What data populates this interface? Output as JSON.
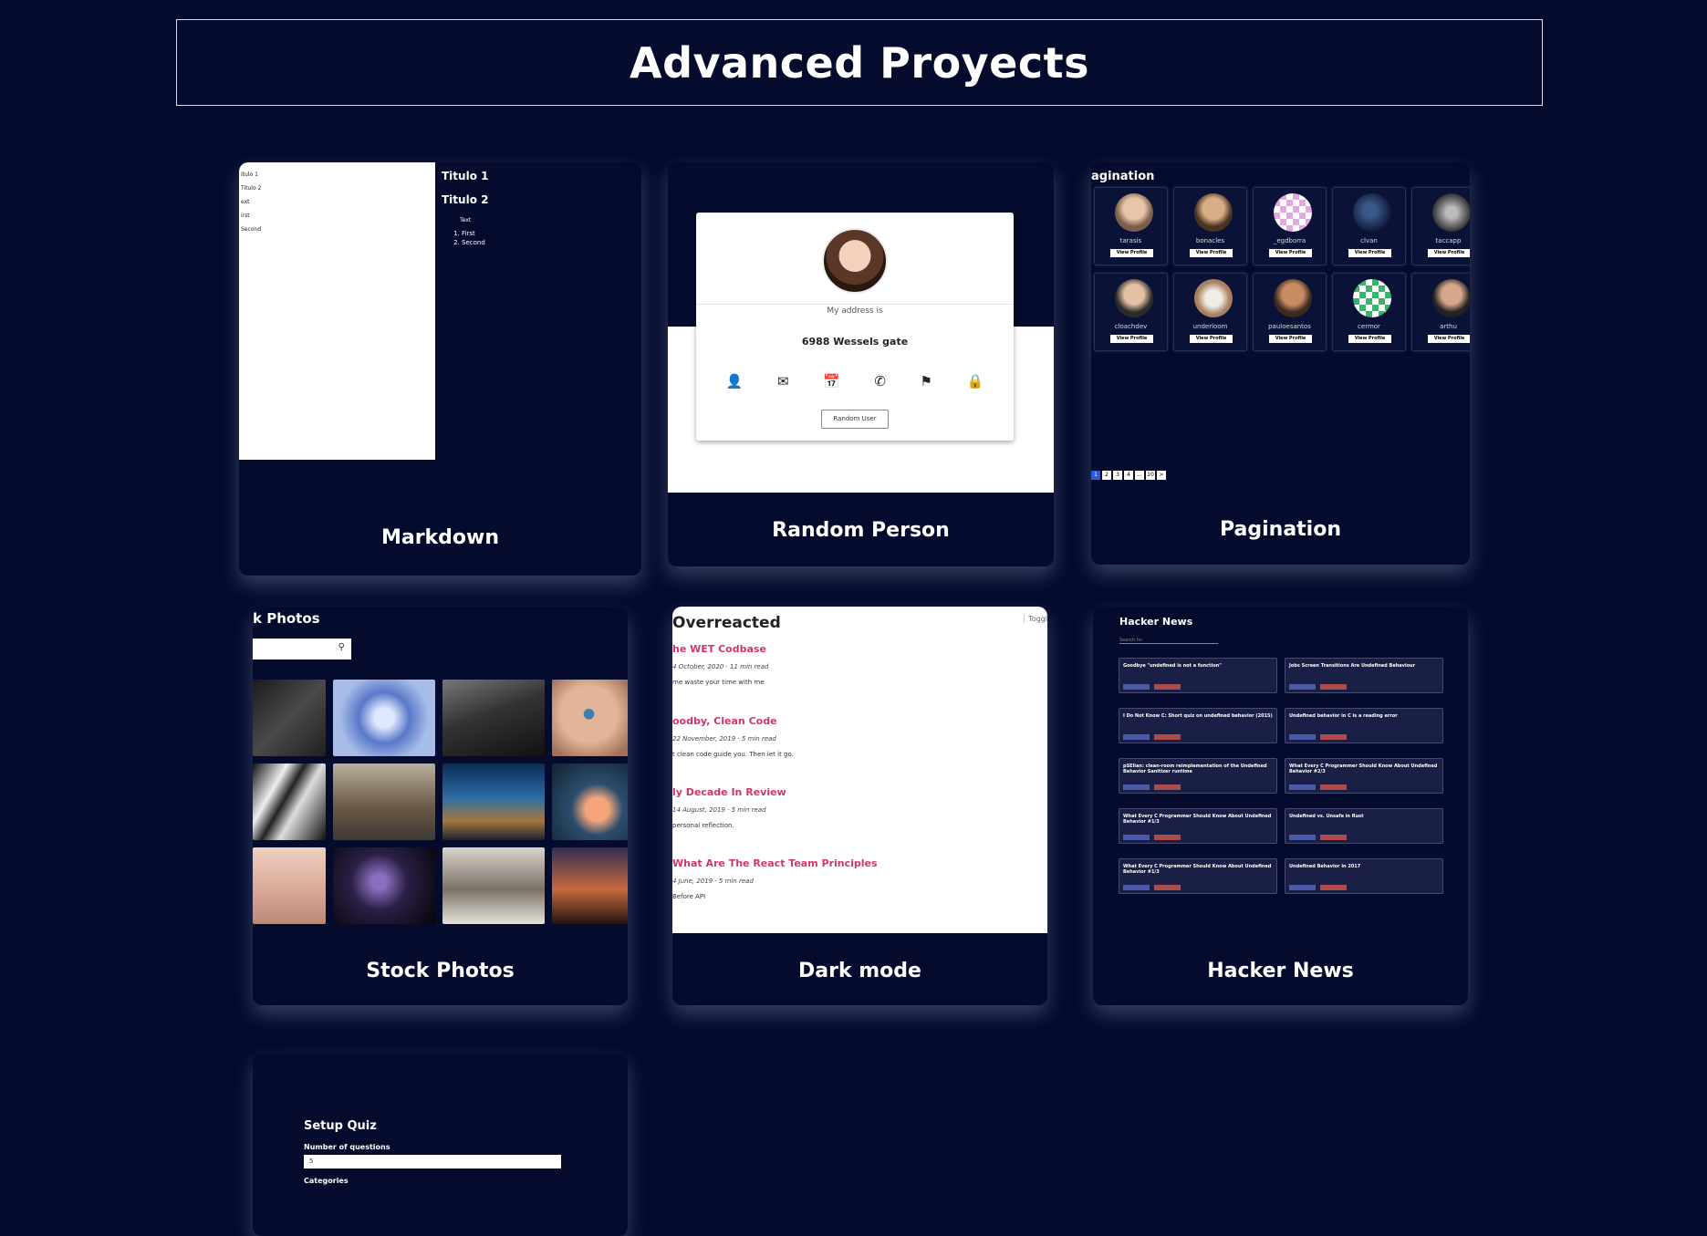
{
  "page": {
    "title": "Advanced Proyects"
  },
  "cards": {
    "markdown": {
      "title": "Markdown",
      "editor_lines": [
        "itulo 1",
        "Titulo 2",
        "ext",
        "irst",
        "Second"
      ],
      "preview": {
        "h1": "Titulo 1",
        "h2": "Titulo 2",
        "text": "Text",
        "list": [
          "First",
          "Second"
        ]
      }
    },
    "random_person": {
      "title": "Random Person",
      "label": "My address is",
      "value": "6988 Wessels gate",
      "button": "Random User",
      "icons": [
        "user-icon",
        "mail-icon",
        "calendar-icon",
        "phone-icon",
        "map-icon",
        "lock-icon"
      ]
    },
    "pagination": {
      "title": "Pagination",
      "header": "agination",
      "view_label": "View Profile",
      "users": [
        "tarasis",
        "bonacles",
        "_egdborra",
        "clvan",
        "taccapp",
        "cloachdev",
        "underloom",
        "pauloesantos",
        "cermor",
        "arthu"
      ],
      "pages": [
        "1",
        "2",
        "3",
        "4",
        "...",
        "10",
        ">"
      ]
    },
    "stock_photos": {
      "title": "Stock Photos",
      "header": "k Photos"
    },
    "dark_mode": {
      "title": "Dark mode",
      "blog_title": "Overreacted",
      "toggle": "Toggl",
      "posts": [
        {
          "title": "he WET Codbase",
          "meta": "4 October, 2020 · 11 min read",
          "desc": "me waste your time with me"
        },
        {
          "title": "oodby, Clean Code",
          "meta": "22 November, 2019 · 5 min read",
          "desc": "t clean code guide you. Then let it go."
        },
        {
          "title": "ly Decade In Review",
          "meta": "14 August, 2019 · 5 min read",
          "desc": "personal reflection."
        },
        {
          "title": "What Are The React Team Principles",
          "meta": "4 June, 2019 · 5 min read",
          "desc": "Before API"
        }
      ]
    },
    "hacker_news": {
      "title": "Hacker News",
      "header": "Hacker News",
      "search": "Search hn",
      "items": [
        "Goodbye \"undefined is not a function\"",
        "Jobs Screen Transitions Are Undefined Behaviour",
        "I Do Not Know C: Short quiz on undefined behavior (2015)",
        "Undefined behavior in C is a reading error",
        "pSElian: clean-room reimplementation of the Undefined Behavior Sanitizer runtime",
        "What Every C Programmer Should Know About Undefined Behavior #2/3",
        "What Every C Programmer Should Know About Undefined Behavior #1/3",
        "Undefined vs. Unsafe in Rust",
        "What Every C Programmer Should Know About Undefined Behavior #1/3",
        "Undefined Behavior in 2017"
      ]
    },
    "quiz": {
      "title": "Setup Quiz",
      "questions_label": "Number of questions",
      "questions_value": "5",
      "category_label": "Categories"
    }
  }
}
